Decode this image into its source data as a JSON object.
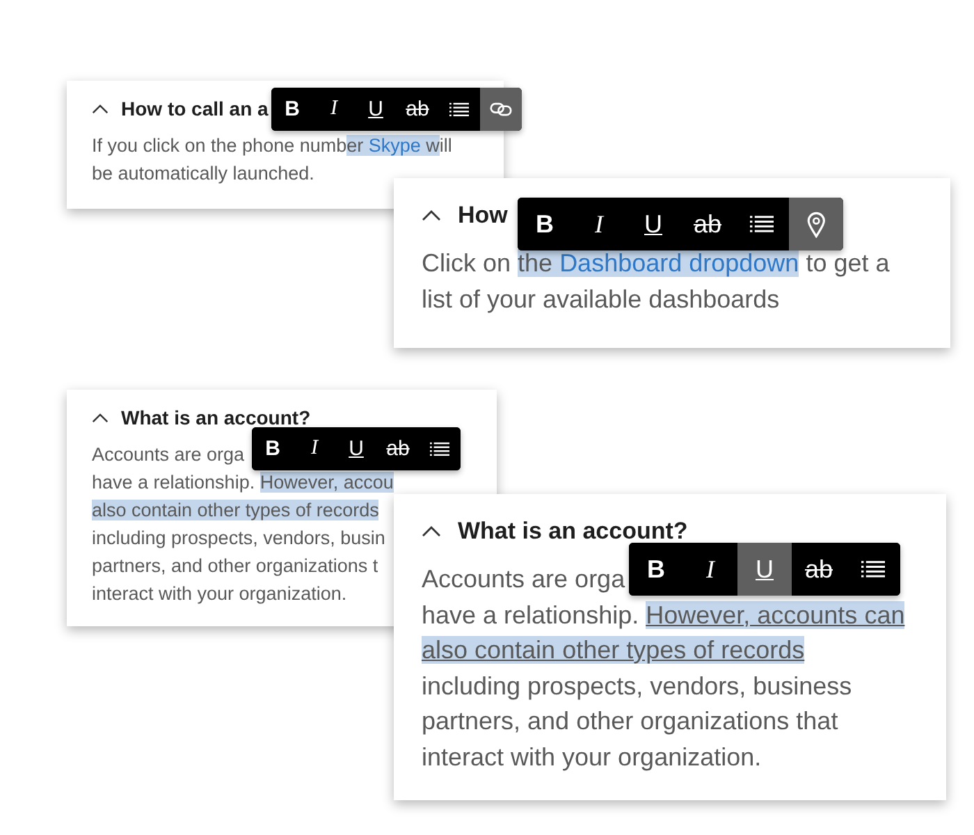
{
  "cards": [
    {
      "title": "How to call an a",
      "lines": [
        [
          {
            "text": "If you click on the phone numb",
            "highlighted": false,
            "link": false,
            "underlined": false
          },
          {
            "text": "er ",
            "highlighted": true,
            "link": false,
            "underlined": false
          },
          {
            "text": "Skype",
            "highlighted": true,
            "link": true,
            "underlined": false
          },
          {
            "text": " w",
            "highlighted": true,
            "link": false,
            "underlined": false
          },
          {
            "text": "ill",
            "highlighted": false,
            "link": false,
            "underlined": false
          }
        ],
        [
          {
            "text": "be automatically launched.",
            "highlighted": false,
            "link": false,
            "underlined": false
          }
        ]
      ],
      "toolbar": [
        {
          "kind": "bold",
          "label": "B",
          "selected": false
        },
        {
          "kind": "italic",
          "label": "I",
          "selected": false
        },
        {
          "kind": "underline",
          "label": "U",
          "selected": false
        },
        {
          "kind": "strike",
          "label": "ab",
          "selected": false
        },
        {
          "kind": "list",
          "selected": false
        },
        {
          "kind": "link",
          "selected": true
        }
      ]
    },
    {
      "title": "How",
      "lines": [
        [
          {
            "text": "Click on ",
            "highlighted": false,
            "link": false,
            "underlined": false
          },
          {
            "text": "the ",
            "highlighted": true,
            "link": false,
            "underlined": false
          },
          {
            "text": "Dashboard dropdown",
            "highlighted": true,
            "link": true,
            "underlined": false
          },
          {
            "text": " to get a",
            "highlighted": false,
            "link": false,
            "underlined": false
          }
        ],
        [
          {
            "text": "list of your available dashboards",
            "highlighted": false,
            "link": false,
            "underlined": false
          }
        ]
      ],
      "toolbar": [
        {
          "kind": "bold",
          "label": "B",
          "selected": false
        },
        {
          "kind": "italic",
          "label": "I",
          "selected": false
        },
        {
          "kind": "underline",
          "label": "U",
          "selected": false
        },
        {
          "kind": "strike",
          "label": "ab",
          "selected": false
        },
        {
          "kind": "list",
          "selected": false
        },
        {
          "kind": "pin",
          "selected": true
        }
      ]
    },
    {
      "title": "What is an account?",
      "lines": [
        [
          {
            "text": "Accounts are orga",
            "highlighted": false,
            "link": false,
            "underlined": false
          }
        ],
        [
          {
            "text": "have a relationship. ",
            "highlighted": false,
            "link": false,
            "underlined": false
          },
          {
            "text": "However, accou",
            "highlighted": true,
            "link": false,
            "underlined": false
          }
        ],
        [
          {
            "text": "also contain other types of records",
            "highlighted": true,
            "link": false,
            "underlined": false
          }
        ],
        [
          {
            "text": "including prospects, vendors, busin",
            "highlighted": false,
            "link": false,
            "underlined": false
          }
        ],
        [
          {
            "text": "partners, and other organizations t",
            "highlighted": false,
            "link": false,
            "underlined": false
          }
        ],
        [
          {
            "text": "interact with your organization.",
            "highlighted": false,
            "link": false,
            "underlined": false
          }
        ]
      ],
      "toolbar": [
        {
          "kind": "bold",
          "label": "B",
          "selected": false
        },
        {
          "kind": "italic",
          "label": "I",
          "selected": false
        },
        {
          "kind": "underline",
          "label": "U",
          "selected": false
        },
        {
          "kind": "strike",
          "label": "ab",
          "selected": false
        },
        {
          "kind": "list",
          "selected": false
        }
      ]
    },
    {
      "title": "What is an account?",
      "lines": [
        [
          {
            "text": "Accounts are orga",
            "highlighted": false,
            "link": false,
            "underlined": false
          }
        ],
        [
          {
            "text": "have a relationship. ",
            "highlighted": false,
            "link": false,
            "underlined": false
          },
          {
            "text": "However, accounts can",
            "highlighted": true,
            "link": false,
            "underlined": true
          }
        ],
        [
          {
            "text": "also contain other types of records",
            "highlighted": true,
            "link": false,
            "underlined": true
          }
        ],
        [
          {
            "text": "including prospects, vendors, business",
            "highlighted": false,
            "link": false,
            "underlined": false
          }
        ],
        [
          {
            "text": "partners, and other organizations that",
            "highlighted": false,
            "link": false,
            "underlined": false
          }
        ],
        [
          {
            "text": "interact with your organization.",
            "highlighted": false,
            "link": false,
            "underlined": false
          }
        ]
      ],
      "toolbar": [
        {
          "kind": "bold",
          "label": "B",
          "selected": false
        },
        {
          "kind": "italic",
          "label": "I",
          "selected": false
        },
        {
          "kind": "underline",
          "label": "U",
          "selected": true
        },
        {
          "kind": "strike",
          "label": "ab",
          "selected": false
        },
        {
          "kind": "list",
          "selected": false
        }
      ]
    }
  ]
}
